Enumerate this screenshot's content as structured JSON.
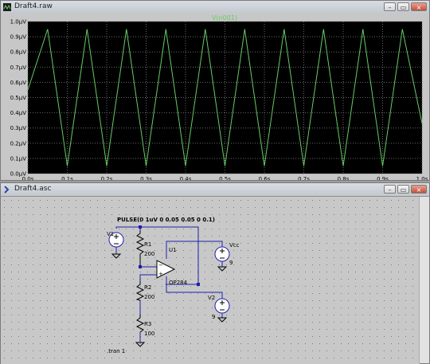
{
  "plot_window": {
    "title": "Draft4.raw",
    "buttons": {
      "minimize": "–",
      "restore": "▭",
      "close": "×"
    },
    "trace_label": "V(n001)",
    "trace_color": "#66cc66",
    "background": "#000000",
    "grid_color": "#6a6a6a"
  },
  "chart_data": {
    "type": "line",
    "series": [
      {
        "name": "V(n001)",
        "x": [
          0.0,
          0.05,
          0.1,
          0.15,
          0.2,
          0.25,
          0.3,
          0.35,
          0.4,
          0.45,
          0.5,
          0.55,
          0.6,
          0.65,
          0.7,
          0.75,
          0.8,
          0.85,
          0.9,
          0.95,
          1.0
        ],
        "y": [
          0.55,
          0.95,
          0.05,
          0.95,
          0.05,
          0.95,
          0.05,
          0.95,
          0.05,
          0.95,
          0.05,
          0.95,
          0.05,
          0.95,
          0.05,
          0.95,
          0.05,
          0.95,
          0.05,
          0.95,
          0.33
        ]
      }
    ],
    "xlim": [
      0,
      1.0
    ],
    "ylim": [
      0,
      1.0
    ],
    "x_ticks": [
      "0.0s",
      "0.1s",
      "0.2s",
      "0.3s",
      "0.4s",
      "0.5s",
      "0.6s",
      "0.7s",
      "0.8s",
      "0.9s",
      "1.0s"
    ],
    "y_ticks": [
      "0.0µV",
      "0.1µV",
      "0.2µV",
      "0.3µV",
      "0.4µV",
      "0.5µV",
      "0.6µV",
      "0.7µV",
      "0.8µV",
      "0.9µV",
      "1.0µV"
    ],
    "grid": true
  },
  "schematic_window": {
    "title": "Draft4.asc",
    "buttons": {
      "minimize": "–",
      "restore": "▭",
      "close": "×"
    },
    "directive": "PULSE(0 1uV 0 0.05 0.05 0 0.1)",
    "sim_command": ".tran 1",
    "components": {
      "v1": {
        "name": "V1"
      },
      "v2": {
        "name": "V2",
        "value": "9"
      },
      "vcc": {
        "name": "Vcc",
        "value": "9"
      },
      "r1": {
        "name": "R1",
        "value": "200"
      },
      "r2": {
        "name": "R2",
        "value": "200"
      },
      "r3": {
        "name": "R3",
        "value": "100"
      },
      "u1": {
        "name": "U1",
        "model": "OP284"
      }
    },
    "wire_color": "#1f1fb0",
    "component_color": "#000000",
    "background": "#c8c8c8"
  }
}
